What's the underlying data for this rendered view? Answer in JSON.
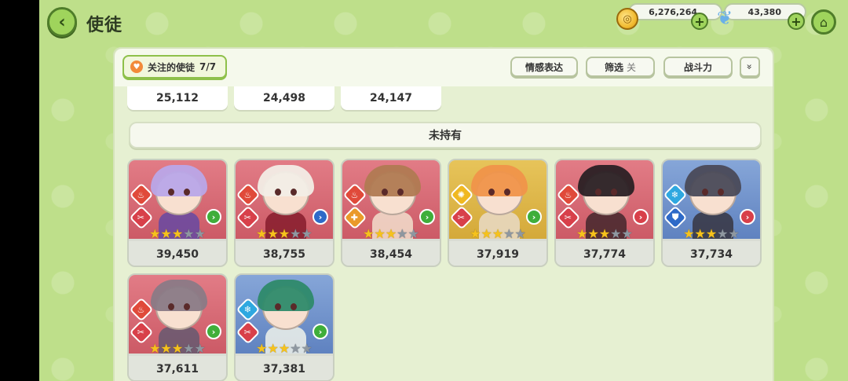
{
  "header": {
    "title": "使徒",
    "back_icon": "‹",
    "coins": "6,276,264",
    "gems": "43,380"
  },
  "panel": {
    "favorites_label": "关注的使徒",
    "favorites_count": "7/7",
    "emotion_label": "情感表达",
    "filter_label": "筛选",
    "filter_state": "关",
    "sort_label": "战斗力",
    "expand_icon": "»"
  },
  "owned_partial": [
    "25,112",
    "24,498",
    "24,147"
  ],
  "section": {
    "not_owned_label": "未持有"
  },
  "cards": [
    {
      "power": "39,450",
      "stars": 3,
      "element": "fire",
      "role": "attacker",
      "arrow": "green",
      "bg": "red",
      "hair": "#b9a6e8",
      "body": "#6b4aa0"
    },
    {
      "power": "38,755",
      "stars": 3,
      "element": "fire",
      "role": "attacker",
      "arrow": "blue",
      "bg": "red",
      "hair": "#f2ede6",
      "body": "#8a2030"
    },
    {
      "power": "38,454",
      "stars": 3,
      "element": "fire",
      "role": "support",
      "arrow": "green",
      "bg": "red",
      "hair": "#b07a52",
      "body": "#f0d8c8"
    },
    {
      "power": "37,919",
      "stars": 3,
      "element": "light",
      "role": "attacker",
      "arrow": "green",
      "bg": "yellow",
      "hair": "#f0944a",
      "body": "#e8d8c0"
    },
    {
      "power": "37,774",
      "stars": 3,
      "element": "fire",
      "role": "attacker",
      "arrow": "red",
      "bg": "red",
      "hair": "#2a2024",
      "body": "#4a2a30"
    },
    {
      "power": "37,734",
      "stars": 3,
      "element": "ice",
      "role": "defender",
      "arrow": "red",
      "bg": "blue",
      "hair": "#4a4a58",
      "body": "#3a3a48"
    },
    {
      "power": "37,611",
      "stars": 3,
      "element": "fire",
      "role": "attacker",
      "arrow": "green",
      "bg": "red",
      "hair": "#8a7a86",
      "body": "#6a5a70"
    },
    {
      "power": "37,381",
      "stars": 3,
      "element": "ice",
      "role": "attacker",
      "arrow": "green",
      "bg": "blue",
      "hair": "#2e8a6a",
      "body": "#e8ece8"
    }
  ]
}
